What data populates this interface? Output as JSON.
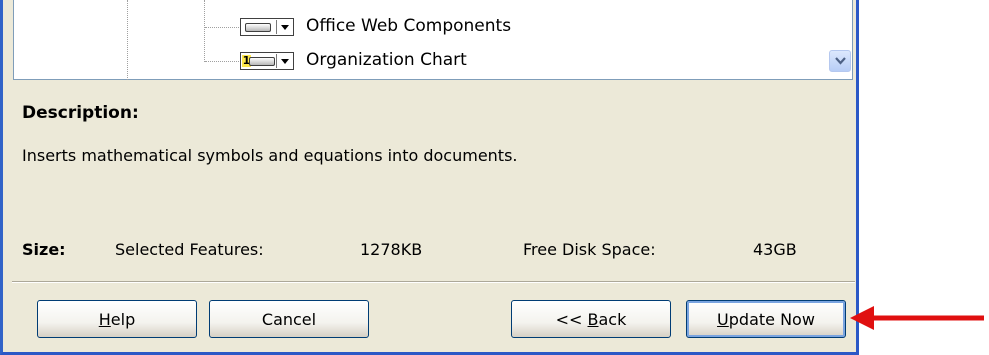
{
  "tree": {
    "items": [
      {
        "label": "Office Web Components",
        "icon": "hard-drive-icon"
      },
      {
        "label": "Organization Chart",
        "icon": "install-on-first-use-icon",
        "badge": "1"
      }
    ]
  },
  "description": {
    "heading": "Description:",
    "text": "Inserts mathematical symbols and equations into documents."
  },
  "size": {
    "label": "Size:",
    "selected_label": "Selected Features:",
    "selected_value": "1278KB",
    "free_label": "Free Disk Space:",
    "free_value": "43GB"
  },
  "buttons": {
    "help": {
      "mnemonic": "H",
      "rest": "elp"
    },
    "cancel": {
      "label": "Cancel"
    },
    "back": {
      "pre": "<< ",
      "mnemonic": "B",
      "rest": "ack"
    },
    "update": {
      "mnemonic": "U",
      "rest": "pdate Now"
    }
  },
  "colors": {
    "window_bg": "#ece9d8",
    "xp_blue_border": "#2b58c6",
    "annotation_arrow": "#e01010"
  }
}
